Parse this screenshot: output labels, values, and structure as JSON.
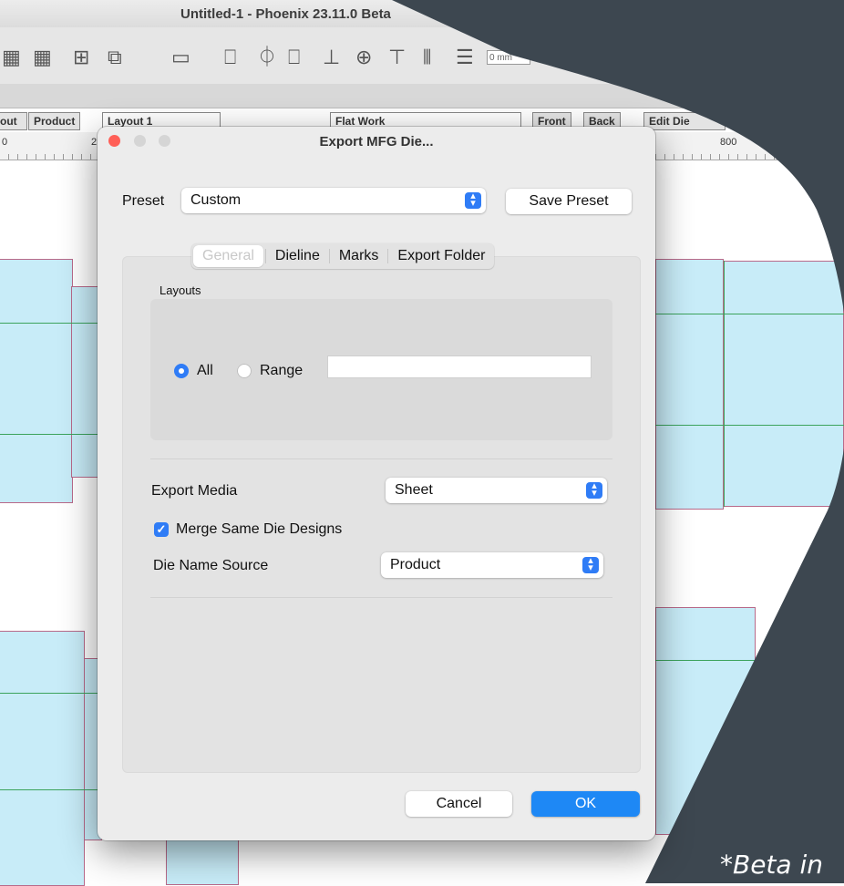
{
  "app": {
    "window_title": "Untitled-1 - Phoenix 23.11.0 Beta",
    "mm_field": "0 mm",
    "left_tabs": [
      "out",
      "Product"
    ],
    "layout_select": "Layout 1",
    "work_select": "Flat Work",
    "right_buttons": [
      "Front",
      "Back",
      "Edit Die"
    ],
    "ruler_labels": [
      "0",
      "2",
      "800"
    ]
  },
  "dialog": {
    "title": "Export MFG Die...",
    "preset_label": "Preset",
    "preset_value": "Custom",
    "save_preset_label": "Save Preset",
    "tabs": [
      "General",
      "Dieline",
      "Marks",
      "Export Folder"
    ],
    "layouts_label": "Layouts",
    "radio_all": "All",
    "radio_range": "Range",
    "range_value": "",
    "export_media_label": "Export Media",
    "export_media_value": "Sheet",
    "merge_checkbox_label": "Merge Same Die Designs",
    "merge_checked": true,
    "die_name_source_label": "Die Name Source",
    "die_name_source_value": "Product",
    "cancel_label": "Cancel",
    "ok_label": "OK"
  },
  "overlay": {
    "beta_text": "*Beta in"
  },
  "colors": {
    "accent": "#2f7cf6",
    "dark_panel": "#3d4750",
    "die_fill": "#c8ecf8",
    "fold_line": "#3ca35c",
    "cut_line": "#b86a8a"
  }
}
